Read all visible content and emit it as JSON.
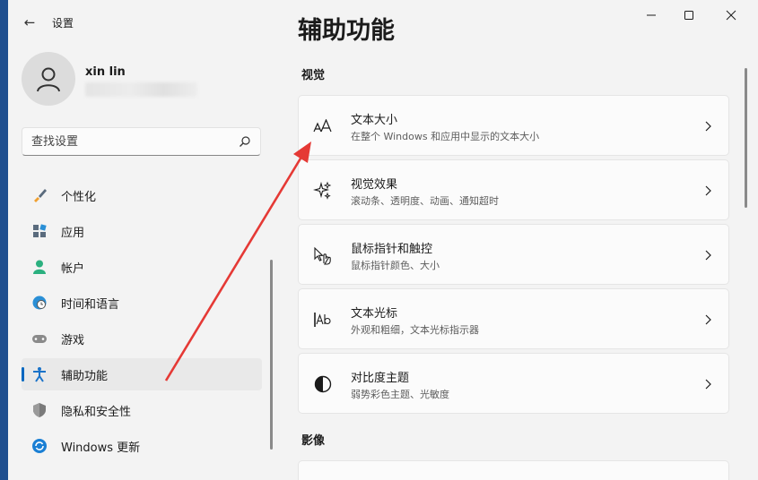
{
  "window": {
    "app_title": "设置",
    "back_icon": "arrow-left-icon",
    "controls": [
      "minimize-icon",
      "maximize-icon",
      "close-icon"
    ]
  },
  "profile": {
    "name": "xin lin",
    "avatar_icon": "person-icon"
  },
  "search": {
    "placeholder": "查找设置",
    "icon": "search-icon"
  },
  "sidebar": {
    "items": [
      {
        "label": "个性化",
        "icon": "brush-icon",
        "color": "#f0a030"
      },
      {
        "label": "应用",
        "icon": "apps-icon",
        "color": "#4a6fa5"
      },
      {
        "label": "帐户",
        "icon": "account-icon",
        "color": "#2bb07f"
      },
      {
        "label": "时间和语言",
        "icon": "globe-clock-icon",
        "color": "#2a8fd6"
      },
      {
        "label": "游戏",
        "icon": "gamepad-icon",
        "color": "#8a8a8a"
      },
      {
        "label": "辅助功能",
        "icon": "accessibility-icon",
        "color": "#1a73c9",
        "active": true
      },
      {
        "label": "隐私和安全性",
        "icon": "shield-icon",
        "color": "#7a7a7a"
      },
      {
        "label": "Windows 更新",
        "icon": "update-icon",
        "color": "#1a7fd4"
      }
    ]
  },
  "main": {
    "title": "辅助功能",
    "sections": [
      {
        "label": "视觉"
      },
      {
        "label": "影像"
      }
    ],
    "cards": [
      {
        "title": "文本大小",
        "desc": "在整个 Windows 和应用中显示的文本大小",
        "icon": "text-size-icon"
      },
      {
        "title": "视觉效果",
        "desc": "滚动条、透明度、动画、通知超时",
        "icon": "sparkle-icon"
      },
      {
        "title": "鼠标指针和触控",
        "desc": "鼠标指针颜色、大小",
        "icon": "pointer-touch-icon"
      },
      {
        "title": "文本光标",
        "desc": "外观和粗细，文本光标指示器",
        "icon": "text-cursor-icon"
      },
      {
        "title": "对比度主题",
        "desc": "弱势彩色主题、光敏度",
        "icon": "contrast-icon"
      }
    ]
  },
  "annotation": {
    "arrow_color": "#e53935"
  }
}
